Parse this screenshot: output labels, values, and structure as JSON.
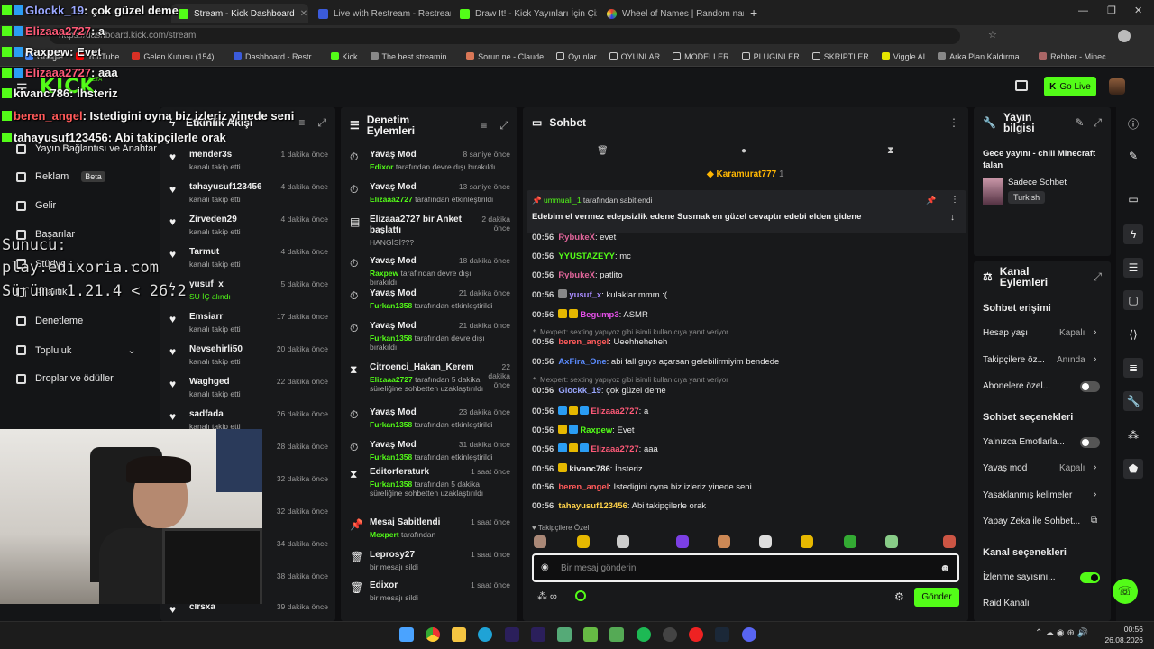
{
  "browser": {
    "tabs": [
      {
        "label": "Stream - Kick Dashboard",
        "active": true
      },
      {
        "label": "Live with Restream - Restream"
      },
      {
        "label": "Draw It! - Kick Yayınları İçin Çizim"
      },
      {
        "label": "Wheel of Names | Random name"
      }
    ],
    "url": "https://dashboard.kick.com/stream",
    "bookmarks": [
      "Google",
      "YouTube",
      "Gelen Kutusu (154)...",
      "Dashboard - Restr...",
      "Kick",
      "The best streamin...",
      "Sorun ne - Claude",
      "Oyunlar",
      "OYUNLAR",
      "MODELLER",
      "PLUGINLER",
      "SKRIPTLER",
      "Viggle AI",
      "Arka Plan Kaldırma...",
      "Rehber - Minec..."
    ]
  },
  "header": {
    "logo": "KICK",
    "beta": "BETA",
    "go_live": "Go Live"
  },
  "leftnav": {
    "items": [
      {
        "label": "Yayın Bağlantısı ve Anahtar"
      },
      {
        "label": "Reklam",
        "badge": "Beta"
      },
      {
        "label": "Gelir"
      },
      {
        "label": "Başarılar"
      },
      {
        "label": "Stüdyo"
      },
      {
        "label": "Analitik"
      },
      {
        "label": "Denetleme"
      },
      {
        "label": "Topluluk"
      },
      {
        "label": "Droplar ve ödüller"
      }
    ]
  },
  "activity": {
    "title": "Etkinlik Akışı",
    "rows": [
      {
        "name": "mender3s",
        "sub": "kanalı takip etti",
        "time": "1 dakika önce"
      },
      {
        "name": "tahayusuf123456",
        "sub": "kanalı takip etti",
        "time": "4 dakika önce"
      },
      {
        "name": "Zirveden29",
        "sub": "kanalı takip etti",
        "time": "4 dakika önce"
      },
      {
        "name": "Tarmut",
        "sub": "kanalı takip etti",
        "time": "4 dakika önce"
      },
      {
        "name": "yusuf_x",
        "sub": "SU İÇ alındı",
        "time": "5 dakika önce"
      },
      {
        "name": "Emsiarr",
        "sub": "kanalı takip etti",
        "time": "17 dakika önce"
      },
      {
        "name": "Nevsehirli50",
        "sub": "kanalı takip etti",
        "time": "20 dakika önce"
      },
      {
        "name": "Waghged",
        "sub": "kanalı takip etti",
        "time": "22 dakika önce"
      },
      {
        "name": "sadfada",
        "sub": "kanalı takip etti",
        "time": "26 dakika önce"
      },
      {
        "name": "",
        "sub": "",
        "time": "28 dakika önce"
      },
      {
        "name": "",
        "sub": "",
        "time": "32 dakika önce"
      },
      {
        "name": "",
        "sub": "",
        "time": "32 dakika önce"
      },
      {
        "name": "",
        "sub": "",
        "time": "34 dakika önce"
      },
      {
        "name": "",
        "sub": "",
        "time": "38 dakika önce"
      },
      {
        "name": "clrsxa",
        "sub": "",
        "time": "39 dakika önce"
      }
    ]
  },
  "moderation": {
    "title": "Denetim Eylemleri",
    "rows": [
      {
        "name": "Yavaş Mod",
        "sub_user": "Edixor",
        "sub": "tarafından devre dışı bırakıldı",
        "time": "8 saniye önce"
      },
      {
        "name": "Yavaş Mod",
        "sub_user": "Elizaaa2727",
        "sub": "tarafından etkinleştirildi",
        "time": "13 saniye önce"
      },
      {
        "name": "Elizaaa2727 bir Anket başlattı",
        "sub_user": "",
        "sub": "HANGİSİ???",
        "time": "2 dakika önce"
      },
      {
        "name": "Yavaş Mod",
        "sub_user": "Raxpew",
        "sub": "tarafından devre dışı bırakıldı",
        "time": "18 dakika önce"
      },
      {
        "name": "Yavaş Mod",
        "sub_user": "Furkan1358",
        "sub": "tarafından etkinleştirildi",
        "time": "21 dakika önce"
      },
      {
        "name": "Yavaş Mod",
        "sub_user": "Furkan1358",
        "sub": "tarafından devre dışı bırakıldı",
        "time": "21 dakika önce"
      },
      {
        "name": "Citroenci_Hakan_Kerem",
        "sub_user": "Elizaaa2727",
        "sub": "tarafından 5 dakika süreliğine sohbetten uzaklaştırıldı",
        "time": "22 dakika önce"
      },
      {
        "name": "Yavaş Mod",
        "sub_user": "Furkan1358",
        "sub": "tarafından etkinleştirildi",
        "time": "23 dakika önce"
      },
      {
        "name": "Yavaş Mod",
        "sub_user": "Furkan1358",
        "sub": "tarafından etkinleştirildi",
        "time": "31 dakika önce"
      },
      {
        "name": "Editorferaturk",
        "sub_user": "Furkan1358",
        "sub": "tarafından 5 dakika süreliğine sohbetten uzaklaştırıldı",
        "time": "1 saat önce"
      },
      {
        "name": "Mesaj Sabitlendi",
        "sub_user": "Mexpert",
        "sub": "tarafından",
        "time": "1 saat önce"
      },
      {
        "name": "Leprosy27",
        "sub_user": "",
        "sub": "bir mesajı sildi",
        "time": "1 saat önce"
      },
      {
        "name": "Edixor",
        "sub_user": "",
        "sub": "bir mesajı sildi",
        "time": "1 saat önce"
      }
    ]
  },
  "chat": {
    "title": "Sohbet",
    "top_gifter": "Karamurat777",
    "top_gifter_count": "1",
    "pinned_by": "ummuali_1",
    "pinned_by_suffix": "tarafından sabitlendi",
    "pinned_text": "Edebim el vermez edepsizlik edene Susmak en güzel cevaptır edebi elden gidene",
    "messages": [
      {
        "time": "00:56",
        "user": "RybukeX",
        "color": "#e0659a",
        "text": ": evet"
      },
      {
        "time": "00:56",
        "user": "YYUSTAZEYY",
        "color": "#53fc18",
        "text": ": mc"
      },
      {
        "time": "00:56",
        "user": "RybukeX",
        "color": "#e0659a",
        "text": ": patlito"
      },
      {
        "time": "00:56",
        "user": "yusuf_x",
        "color": "#a98bff",
        "text": ": kulaklarımmm :("
      },
      {
        "time": "00:56",
        "user": "Begump3",
        "color": "#e44fe8",
        "text": ": ASMR"
      },
      {
        "time": "00:56",
        "user": "beren_angel",
        "color": "#ff5a5a",
        "text": ": Ueehheheheh"
      },
      {
        "time": "00:56",
        "user": "AxFira_One",
        "color": "#5b8cff",
        "text": ": abi fall guys açarsan gelebilirmiyim bendede"
      },
      {
        "time": "00:56",
        "user": "Glockk_19",
        "color": "#9aa7ff",
        "text": ": çok güzel deme"
      },
      {
        "time": "00:56",
        "user": "Elizaaa2727",
        "color": "#ff5a78",
        "text": ": a"
      },
      {
        "time": "00:56",
        "user": "Raxpew",
        "color": "#53fc18",
        "text": ": Evet"
      },
      {
        "time": "00:56",
        "user": "Elizaaa2727",
        "color": "#ff5a78",
        "text": ": aaa"
      },
      {
        "time": "00:56",
        "user": "kivanc786",
        "color": "#e8e8e8",
        "text": ": İhsteriz"
      },
      {
        "time": "00:56",
        "user": "beren_angel",
        "color": "#ff5a5a",
        "text": ": Istedigini oyna biz izleriz yinede seni"
      },
      {
        "time": "00:56",
        "user": "tahayusuf123456",
        "color": "#ffd24a",
        "text": ": Abi takipçilerle orak"
      }
    ],
    "reply1": "Mexpert: sexting yapıyoz gibi isimli kullanıcıya yanıt veriyor",
    "reply2": "Mexpert: sexting yapıyoz gibi isimli kullanıcıya yanıt veriyor",
    "followers_only": "Takipçilere Özel",
    "input_placeholder": "Bir mesaj gönderin",
    "send": "Gönder"
  },
  "stream_info": {
    "title": "Yayın bilgisi",
    "stream_title": "Gece yayını - chill Minecraft falan",
    "category": "Sadece Sohbet",
    "language": "Turkish"
  },
  "channel_actions": {
    "title": "Kanal Eylemleri",
    "chat_access_heading": "Sohbet erişimi",
    "account_age_label": "Hesap yaşı",
    "account_age_value": "Kapalı",
    "followers_label": "Takipçilere öz...",
    "followers_value": "Anında",
    "subscribers_label": "Abonelere özel...",
    "chat_options_heading": "Sohbet seçenekleri",
    "emotes_only_label": "Yalnızca Emotlarla...",
    "slow_mode_label": "Yavaş mod",
    "slow_mode_value": "Kapalı",
    "banned_words_label": "Yasaklanmış kelimeler",
    "ai_mod_label": "Yapay Zeka ile Sohbet...",
    "channel_options_heading": "Kanal seçenekleri",
    "viewer_count_label": "İzlenme sayısını...",
    "raid_label": "Raid Kanalı"
  },
  "overlay": {
    "lines": [
      {
        "user": "Glockk_19",
        "text": ": çok güzel deme"
      },
      {
        "user": "Elizaaa2727",
        "text": ": a"
      },
      {
        "user": "Raxpew",
        "text": ": Evet"
      },
      {
        "user": "Elizaaa2727",
        "text": ": aaa"
      },
      {
        "user": "kivanc786",
        "text": ": İhsteriz"
      },
      {
        "user": "beren_angel",
        "text": ": Istedigini oyna biz izleriz yinede seni"
      },
      {
        "user": "tahayusuf123456",
        "text": ": Abi takipçilerle orak"
      }
    ],
    "server_label": "Sunucu:",
    "server_addr": "play.edixoria.com",
    "version": "Sürüm: 1.21.4 < 26.2"
  },
  "taskbar": {
    "time": "00:56",
    "date": "26.08.2026"
  },
  "colors": {
    "accent": "#53fc18",
    "panel": "#18191b",
    "bg": "#0e0e10"
  }
}
